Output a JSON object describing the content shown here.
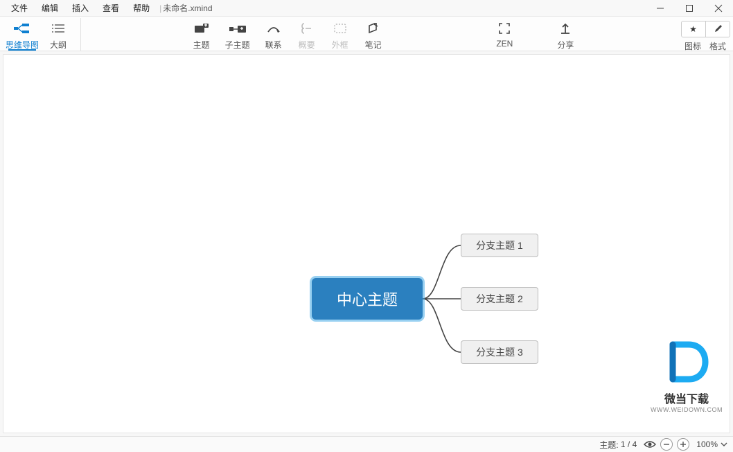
{
  "titlebar": {
    "menus": [
      "文件",
      "编辑",
      "插入",
      "查看",
      "帮助"
    ],
    "separator": "|",
    "filename": "未命名.xmind"
  },
  "toolbar": {
    "mindmap": "思维导图",
    "outline": "大纲",
    "topic": "主题",
    "subtopic": "子主题",
    "relationship": "联系",
    "summary": "概要",
    "boundary": "外框",
    "notes": "笔记",
    "zen": "ZEN",
    "share": "分享",
    "icons": "图标",
    "format": "格式"
  },
  "mindmap": {
    "central": "中心主题",
    "branches": [
      "分支主题 1",
      "分支主题 2",
      "分支主题 3"
    ]
  },
  "statusbar": {
    "topic_label": "主题:",
    "topic_current": "1",
    "topic_sep": "/",
    "topic_total": "4",
    "zoom": "100%"
  },
  "watermark": {
    "logo": "D",
    "text1": "微当下载",
    "text2": "WWW.WEIDOWN.COM"
  }
}
